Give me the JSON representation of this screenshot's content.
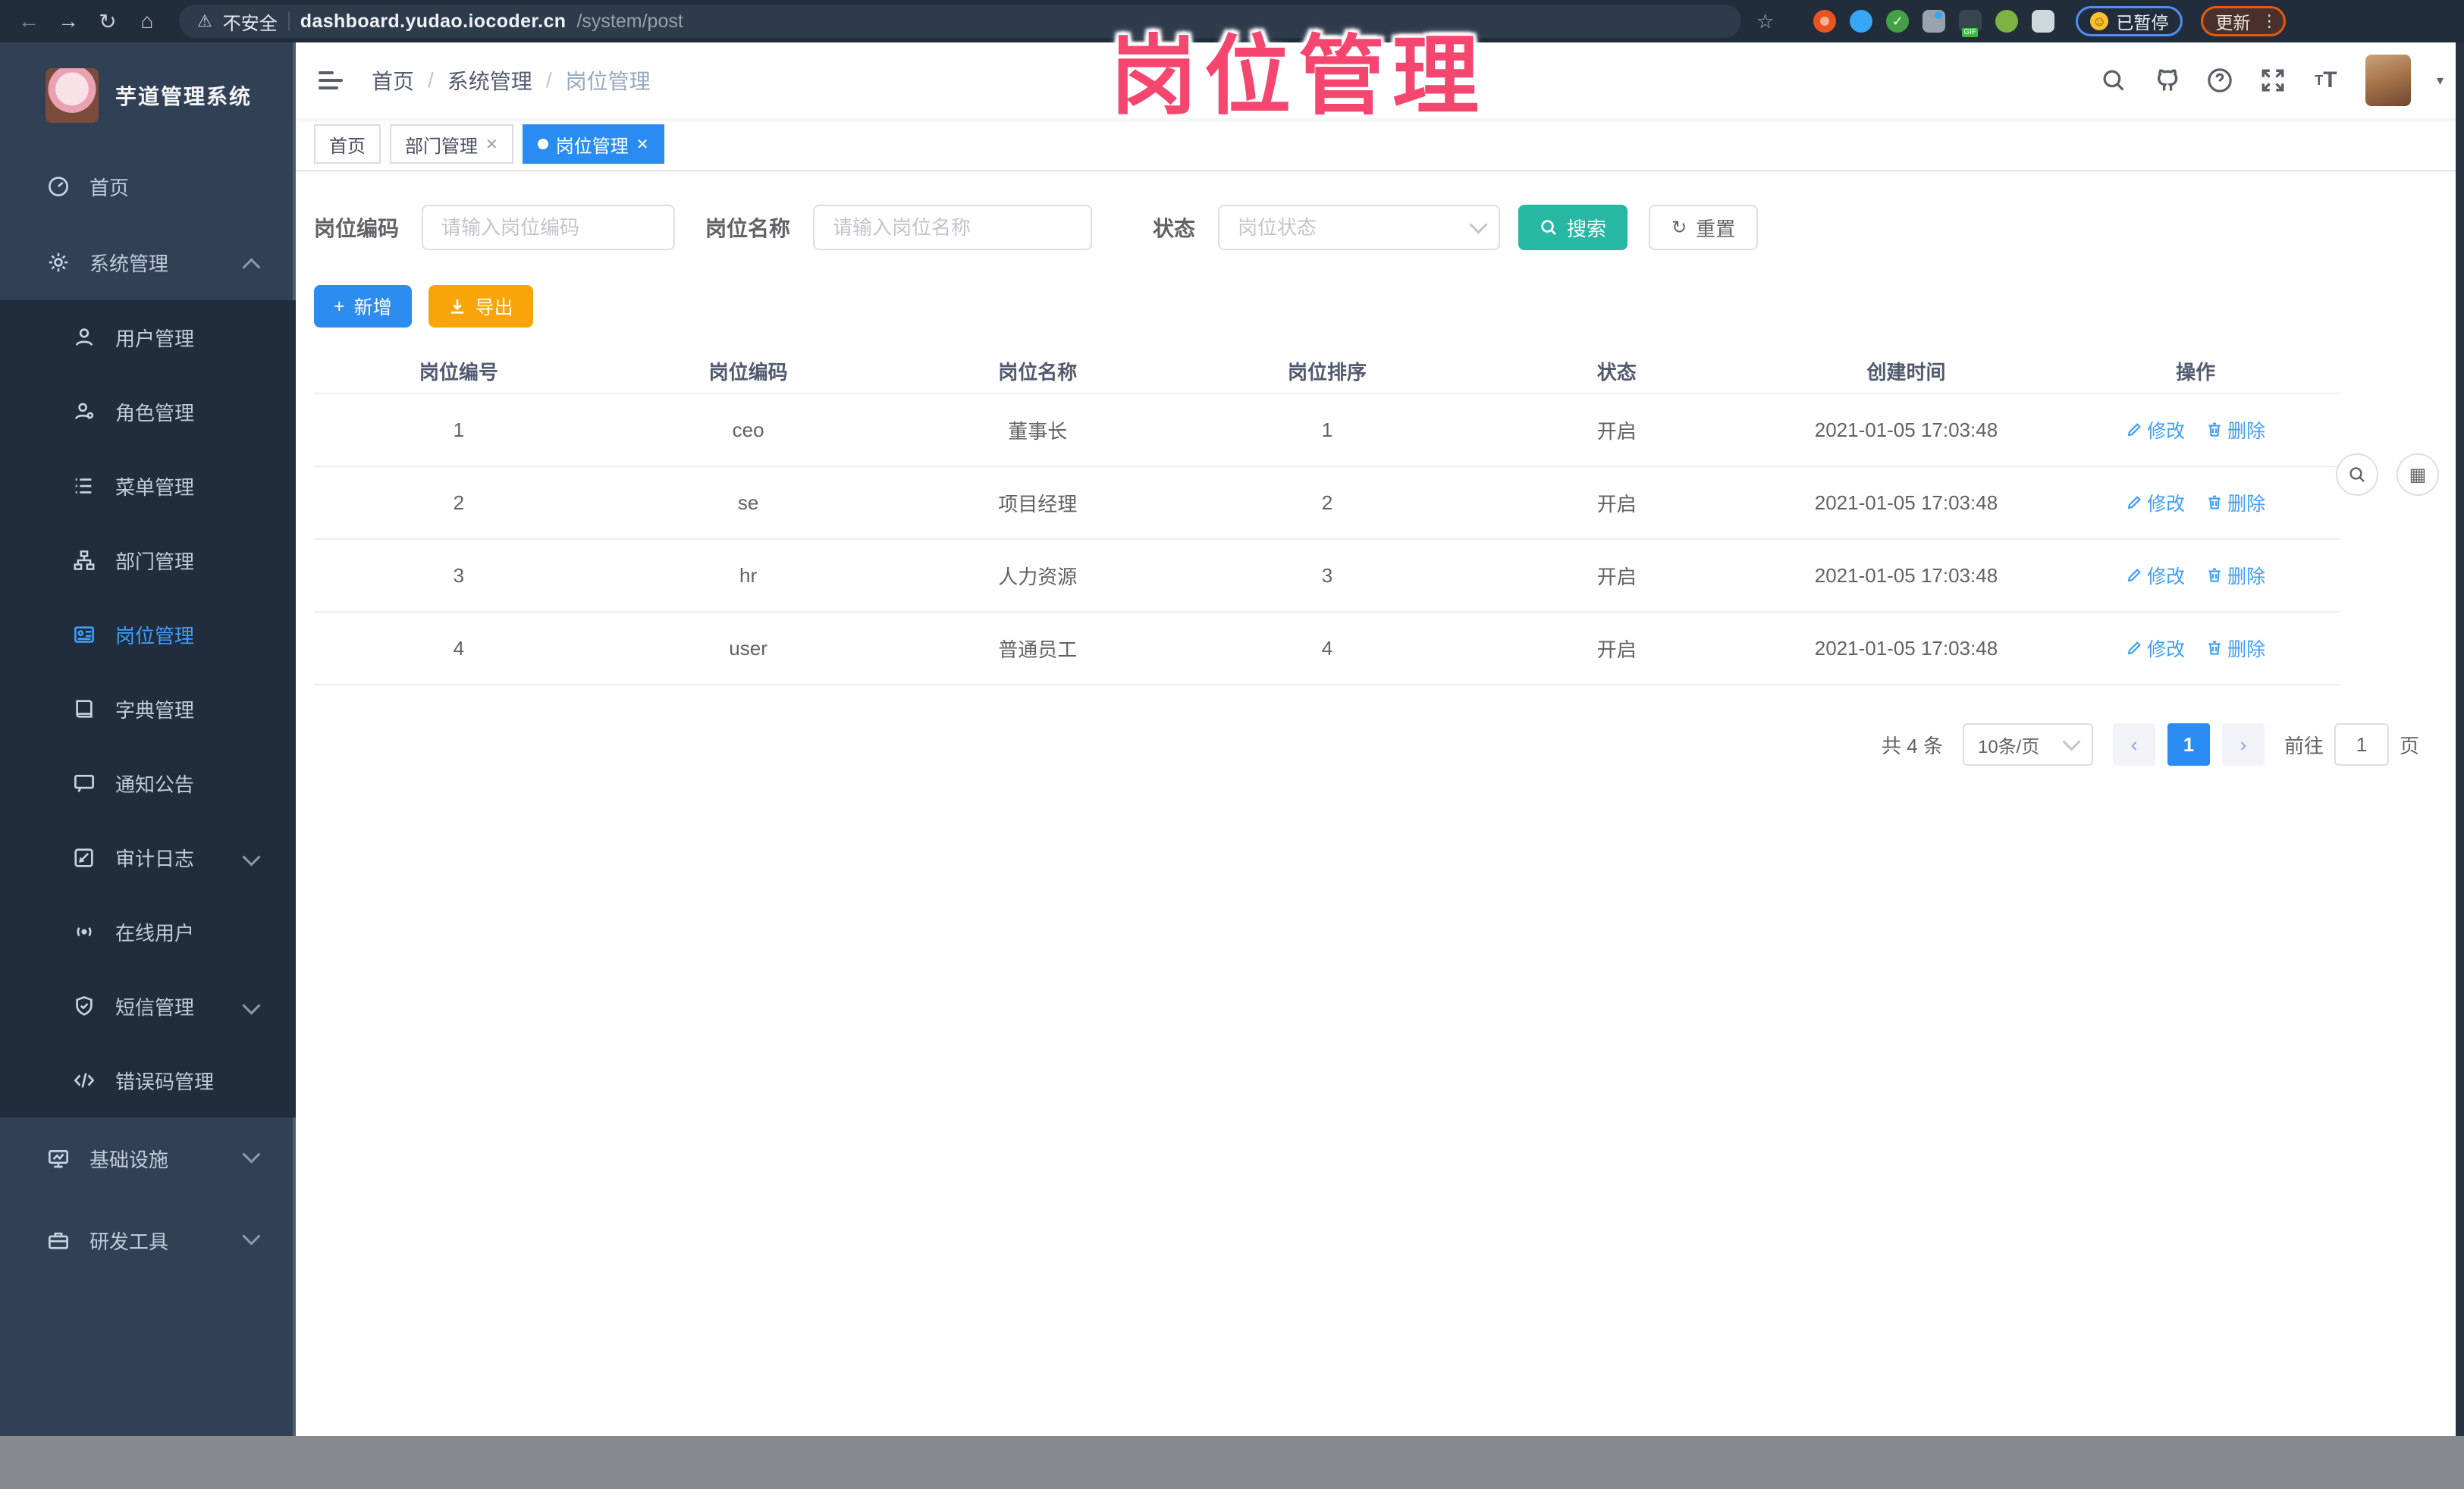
{
  "browser": {
    "security_label": "不安全",
    "url_host": "dashboard.yudao.iocoder.cn",
    "url_path": "/system/post",
    "paused_chip": "已暂停",
    "update_chip": "更新"
  },
  "overlay_title": "岗位管理",
  "sidebar": {
    "app_title": "芋道管理系统",
    "items": [
      {
        "label": "首页"
      },
      {
        "label": "系统管理"
      },
      {
        "label": "用户管理"
      },
      {
        "label": "角色管理"
      },
      {
        "label": "菜单管理"
      },
      {
        "label": "部门管理"
      },
      {
        "label": "岗位管理"
      },
      {
        "label": "字典管理"
      },
      {
        "label": "通知公告"
      },
      {
        "label": "审计日志"
      },
      {
        "label": "在线用户"
      },
      {
        "label": "短信管理"
      },
      {
        "label": "错误码管理"
      },
      {
        "label": "基础设施"
      },
      {
        "label": "研发工具"
      }
    ]
  },
  "breadcrumb": {
    "separator": "/",
    "items": [
      "首页",
      "系统管理",
      "岗位管理"
    ]
  },
  "tabs": [
    {
      "label": "首页"
    },
    {
      "label": "部门管理"
    },
    {
      "label": "岗位管理"
    }
  ],
  "filters": {
    "code_label": "岗位编码",
    "code_placeholder": "请输入岗位编码",
    "name_label": "岗位名称",
    "name_placeholder": "请输入岗位名称",
    "status_label": "状态",
    "status_placeholder": "岗位状态",
    "search_label": "搜索",
    "reset_label": "重置"
  },
  "toolbar": {
    "add_label": "新增",
    "export_label": "导出"
  },
  "table": {
    "columns": [
      "岗位编号",
      "岗位编码",
      "岗位名称",
      "岗位排序",
      "状态",
      "创建时间",
      "操作"
    ],
    "rows": [
      {
        "id": "1",
        "code": "ceo",
        "name": "董事长",
        "sort": "1",
        "status": "开启",
        "created": "2021-01-05 17:03:48"
      },
      {
        "id": "2",
        "code": "se",
        "name": "项目经理",
        "sort": "2",
        "status": "开启",
        "created": "2021-01-05 17:03:48"
      },
      {
        "id": "3",
        "code": "hr",
        "name": "人力资源",
        "sort": "3",
        "status": "开启",
        "created": "2021-01-05 17:03:48"
      },
      {
        "id": "4",
        "code": "user",
        "name": "普通员工",
        "sort": "4",
        "status": "开启",
        "created": "2021-01-05 17:03:48"
      }
    ],
    "row_actions": {
      "edit": "修改",
      "delete": "删除"
    }
  },
  "pagination": {
    "total": "共 4 条",
    "page_size": "10条/页",
    "page": "1",
    "go": "前往",
    "jump": "1",
    "page_unit": "页"
  },
  "colors": {
    "accent": "#409eff",
    "search_teal": "#26b8a2",
    "export_orange": "#f9a50a",
    "add_blue": "#2d8cf0",
    "overlay_pink": "#f5466f",
    "sidebar_bg": "#304156",
    "sidebar_sub_bg": "#1f2d3d"
  }
}
